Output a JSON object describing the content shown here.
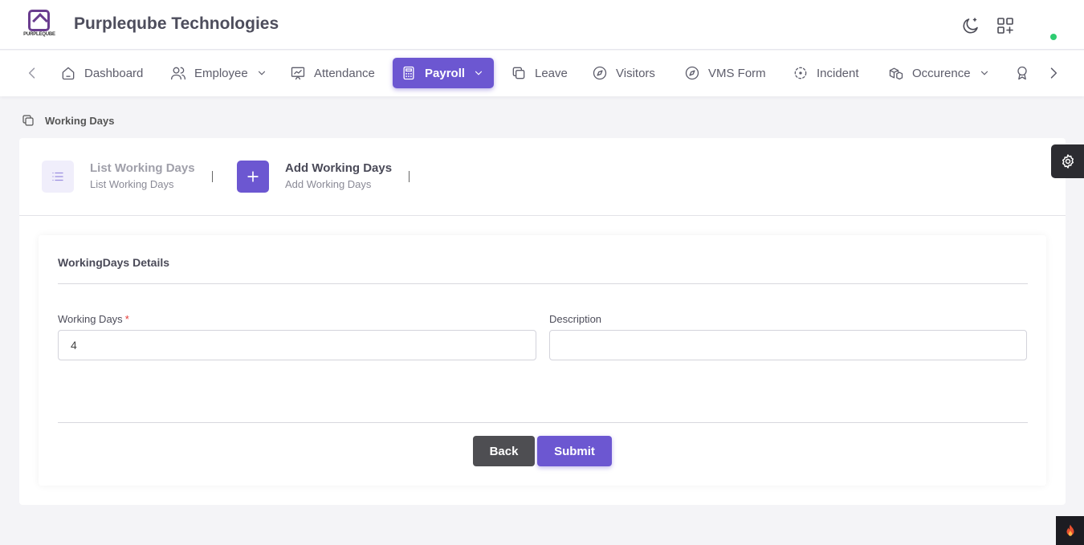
{
  "header": {
    "logo_text": "PURPLEQUBE",
    "company_name": "Purpleqube Technologies"
  },
  "nav": {
    "items": [
      {
        "label": "Dashboard",
        "icon": "home-icon"
      },
      {
        "label": "Employee",
        "icon": "users-icon",
        "dropdown": true
      },
      {
        "label": "Attendance",
        "icon": "presentation-chart-icon"
      },
      {
        "label": "Payroll",
        "icon": "calculator-icon",
        "dropdown": true,
        "active": true
      },
      {
        "label": "Leave",
        "icon": "copy-icon"
      },
      {
        "label": "Visitors",
        "icon": "compass-icon"
      },
      {
        "label": "VMS Form",
        "icon": "compass-icon"
      },
      {
        "label": "Incident",
        "icon": "focus-icon"
      },
      {
        "label": "Occurence",
        "icon": "boxes-icon",
        "dropdown": true
      },
      {
        "label": "",
        "icon": "award-icon"
      }
    ]
  },
  "breadcrumb": {
    "label": "Working Days"
  },
  "tabs": [
    {
      "title": "List Working Days",
      "subtitle": "List Working Days",
      "icon": "list-icon"
    },
    {
      "title": "Add Working Days",
      "subtitle": "Add Working Days",
      "icon": "plus-icon"
    }
  ],
  "form": {
    "section_title": "WorkingDays Details",
    "working_days": {
      "label": "Working Days",
      "required_mark": "*",
      "value": "4"
    },
    "description": {
      "label": "Description",
      "value": ""
    },
    "back_label": "Back",
    "submit_label": "Submit"
  },
  "colors": {
    "accent": "#6c57d1",
    "status_online": "#2ecc71"
  }
}
